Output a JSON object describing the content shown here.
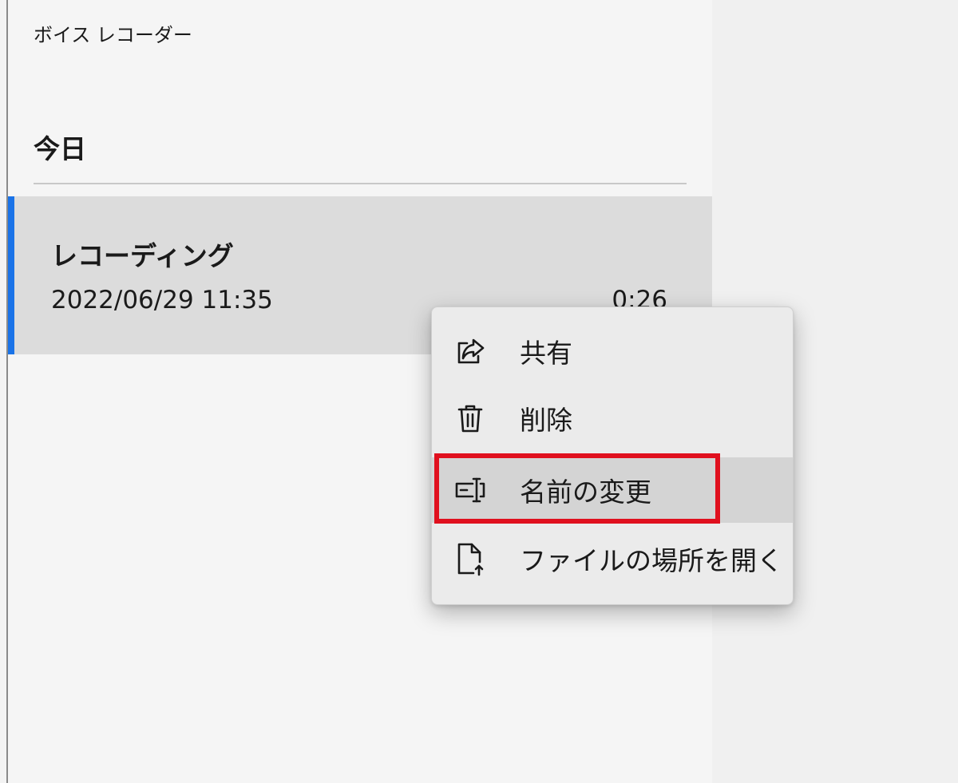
{
  "app": {
    "title": "ボイス レコーダー"
  },
  "list": {
    "section_heading": "今日",
    "items": [
      {
        "name": "レコーディング",
        "datetime": "2022/06/29 11:35",
        "duration": "0:26"
      }
    ]
  },
  "context_menu": {
    "items": [
      {
        "icon": "share-icon",
        "label": "共有"
      },
      {
        "icon": "trash-icon",
        "label": "削除"
      },
      {
        "icon": "rename-icon",
        "label": "名前の変更"
      },
      {
        "icon": "open-file-location-icon",
        "label": "ファイルの場所を開く"
      }
    ]
  },
  "colors": {
    "accent": "#1a73e8",
    "highlight": "#e0101e"
  }
}
